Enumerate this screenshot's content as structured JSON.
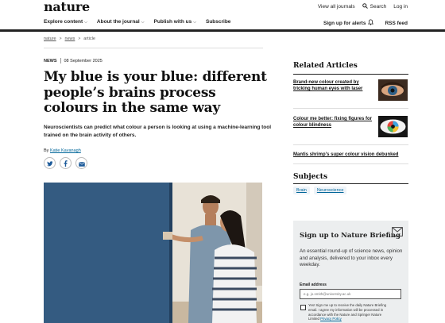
{
  "header": {
    "logo": "nature",
    "top_links": {
      "view_all": "View all journals",
      "search": "Search",
      "login": "Log in"
    },
    "nav": [
      {
        "label": "Explore content",
        "has_menu": true
      },
      {
        "label": "About the journal",
        "has_menu": true
      },
      {
        "label": "Publish with us",
        "has_menu": true
      },
      {
        "label": "Subscribe",
        "has_menu": false
      }
    ],
    "right_nav": {
      "alerts": "Sign up for alerts",
      "rss": "RSS feed"
    }
  },
  "breadcrumb": [
    "nature",
    "news",
    "article"
  ],
  "article": {
    "type": "NEWS",
    "date": "08 September 2025",
    "title": "My blue is your blue: different people’s brains process colours in the same way",
    "standfirst": "Neuroscientists can predict what colour a person is looking at using a machine-learning tool trained on the brain activity of others.",
    "byline_prefix": "By",
    "author": "Katie Kavanagh",
    "share_icons": [
      "twitter-icon",
      "facebook-icon",
      "email-icon"
    ]
  },
  "sidebar": {
    "related_title": "Related Articles",
    "related": [
      {
        "title": "Brand-new colour created by tricking human eyes with laser",
        "thumb": "eye-closeup"
      },
      {
        "title": "Colour me better: fixing figures for colour blindness",
        "thumb": "colourful-eye-illustration"
      },
      {
        "title": "Mantis shrimp's super colour vision debunked",
        "thumb": ""
      }
    ],
    "subjects_title": "Subjects",
    "subjects": [
      "Brain",
      "Neuroscience"
    ]
  },
  "briefing": {
    "title": "Sign up to Nature Briefing",
    "description": "An essential round-up of science news, opinion and analysis, delivered to your inbox every weekday.",
    "email_label": "Email address",
    "email_placeholder": "e.g. jo.smith@university.ac.uk",
    "consent_line1": "Yes! Sign me up to receive the daily Nature Briefing",
    "consent_line2": "email. I agree my information will be processed in",
    "consent_line3": "accordance with the Nature and Springer Nature",
    "consent_line4a": "Limited",
    "consent_link": "Privacy Policy"
  },
  "colors": {
    "accent": "#006699",
    "dark": "#222222",
    "briefing_bg": "#eceeef"
  }
}
